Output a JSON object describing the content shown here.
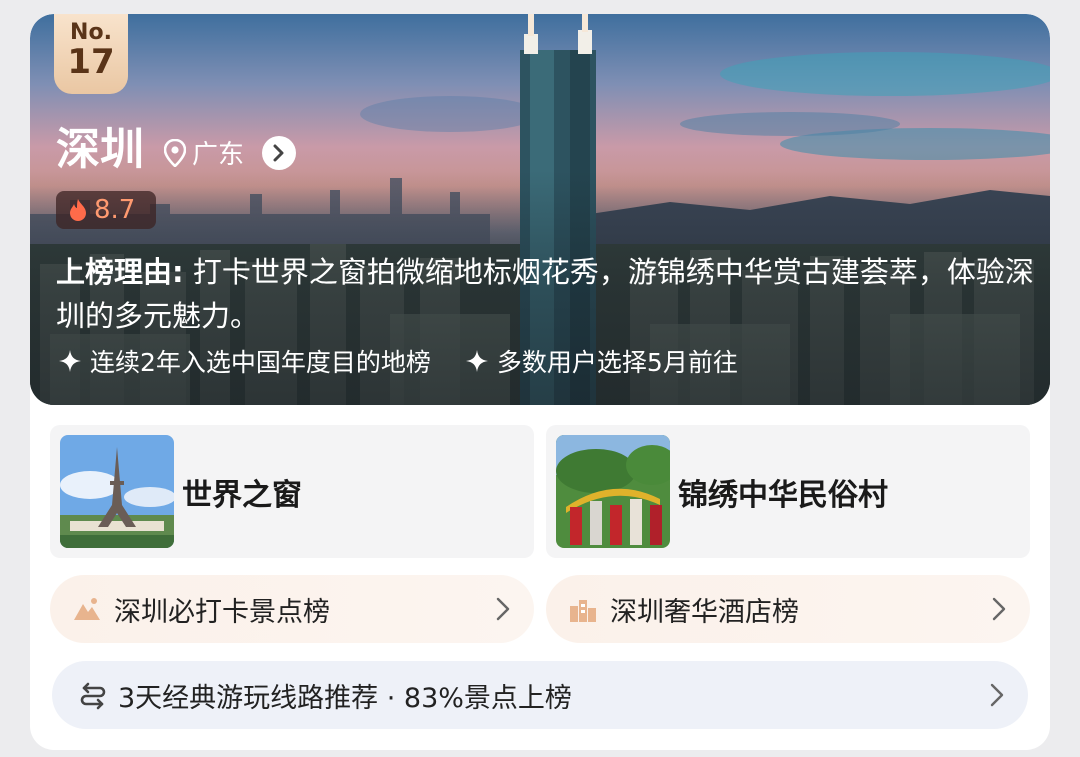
{
  "hero": {
    "rank_prefix": "No.",
    "rank_number": "17",
    "city": "深圳",
    "province": "广东",
    "score": "8.7",
    "reason_label": "上榜理由:",
    "reason_text": "打卡世界之窗拍微缩地标烟花秀，游锦绣中华赏古建荟萃，体验深圳的多元魅力。",
    "tags": [
      "连续2年入选中国年度目的地榜",
      "多数用户选择5月前往"
    ]
  },
  "attractions": [
    {
      "name": "世界之窗"
    },
    {
      "name": "锦绣中华民俗村"
    }
  ],
  "rank_links": [
    {
      "label": "深圳必打卡景点榜",
      "icon": "mountain-icon"
    },
    {
      "label": "深圳奢华酒店榜",
      "icon": "hotel-icon"
    }
  ],
  "route": {
    "label": "3天经典游玩线路推荐 · 83%景点上榜",
    "icon": "route-icon"
  },
  "colors": {
    "accent_orange": "#ff8a5c",
    "rank_badge": "#eac7a3",
    "icon_tan": "#e8b48e"
  }
}
